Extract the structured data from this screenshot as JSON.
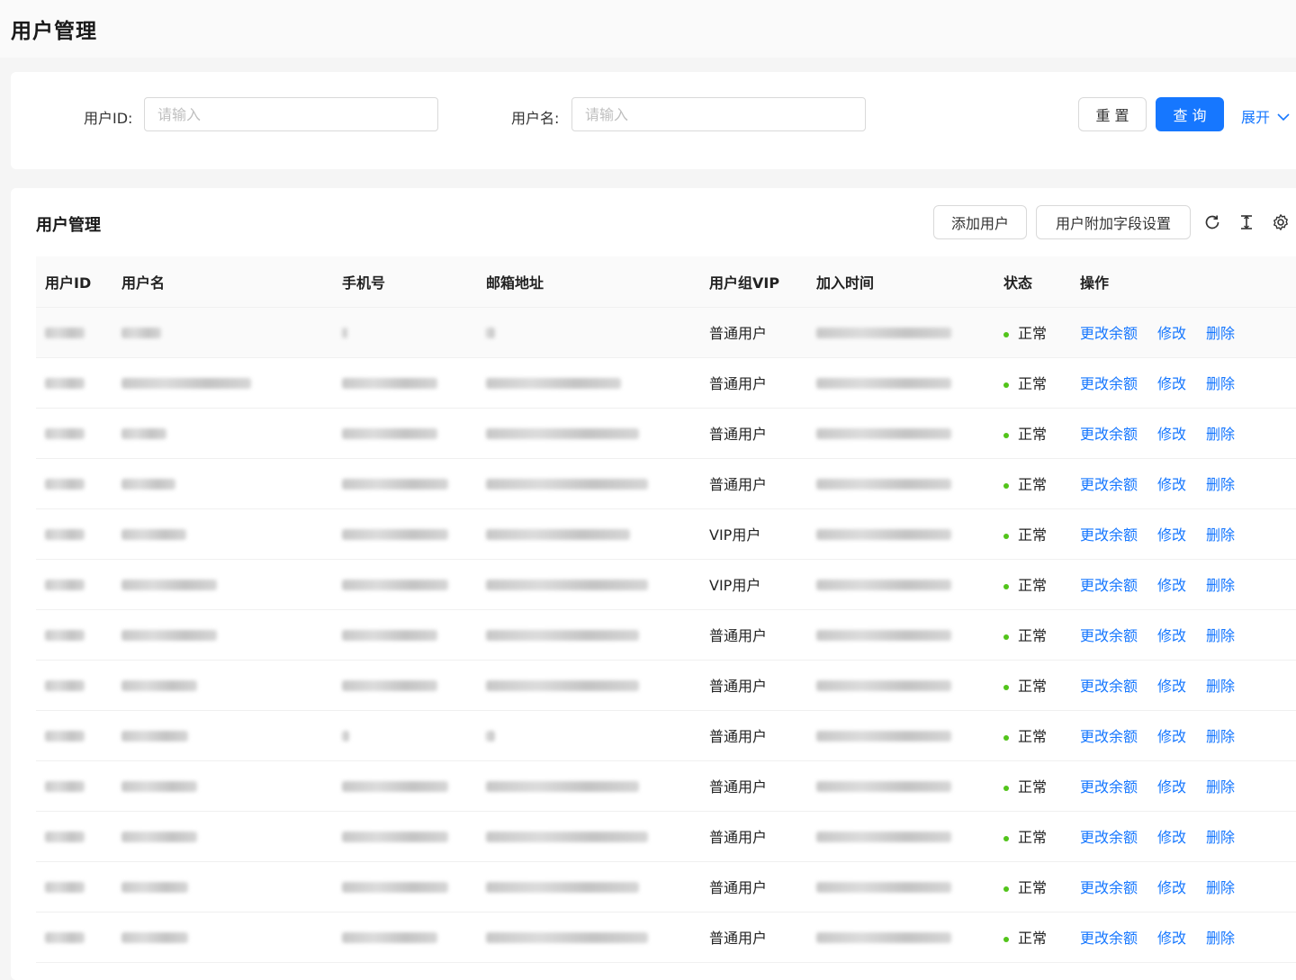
{
  "page": {
    "title": "用户管理"
  },
  "search": {
    "user_id_label": "用户ID:",
    "user_id_placeholder": "请输入",
    "username_label": "用户名:",
    "username_placeholder": "请输入",
    "reset_label": "重 置",
    "query_label": "查 询",
    "expand_label": "展开"
  },
  "table_section": {
    "title": "用户管理",
    "add_user_label": "添加用户",
    "extra_fields_label": "用户附加字段设置",
    "icons": [
      "reload-icon",
      "column-height-icon",
      "setting-icon"
    ]
  },
  "columns": [
    "用户ID",
    "用户名",
    "手机号",
    "邮箱地址",
    "用户组VIP",
    "加入时间",
    "状态",
    "操作"
  ],
  "rows": [
    {
      "group": "普通用户",
      "status": "正常"
    },
    {
      "group": "普通用户",
      "status": "正常"
    },
    {
      "group": "普通用户",
      "status": "正常"
    },
    {
      "group": "普通用户",
      "status": "正常"
    },
    {
      "group": "VIP用户",
      "status": "正常"
    },
    {
      "group": "VIP用户",
      "status": "正常"
    },
    {
      "group": "普通用户",
      "status": "正常"
    },
    {
      "group": "普通用户",
      "status": "正常"
    },
    {
      "group": "普通用户",
      "status": "正常"
    },
    {
      "group": "普通用户",
      "status": "正常"
    },
    {
      "group": "普通用户",
      "status": "正常"
    },
    {
      "group": "普通用户",
      "status": "正常"
    },
    {
      "group": "普通用户",
      "status": "正常"
    }
  ],
  "row_actions": [
    "更改余额",
    "修改",
    "删除"
  ],
  "colors": {
    "primary": "#1677ff",
    "status_normal": "#52c41a"
  }
}
